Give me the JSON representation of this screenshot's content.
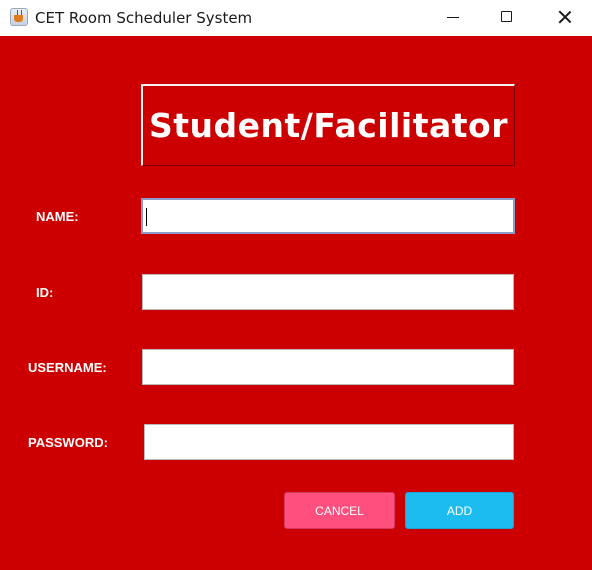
{
  "window": {
    "title": "CET Room Scheduler System",
    "icon": "java-cup-icon",
    "controls": [
      "minimize-icon",
      "maximize-icon",
      "close-icon"
    ]
  },
  "form": {
    "heading": "Student/Facilitator",
    "fields": [
      {
        "label": "NAME:",
        "value": "",
        "focused": true
      },
      {
        "label": "ID:",
        "value": ""
      },
      {
        "label": "USERNAME:",
        "value": ""
      },
      {
        "label": "PASSWORD:",
        "value": ""
      }
    ]
  },
  "buttons": {
    "cancel": "CANCEL",
    "add": "ADD"
  },
  "colors": {
    "background": "#cc0000",
    "cancel_button": "#ff4f7e",
    "add_button": "#1dbcf0",
    "text": "#ffffff"
  }
}
